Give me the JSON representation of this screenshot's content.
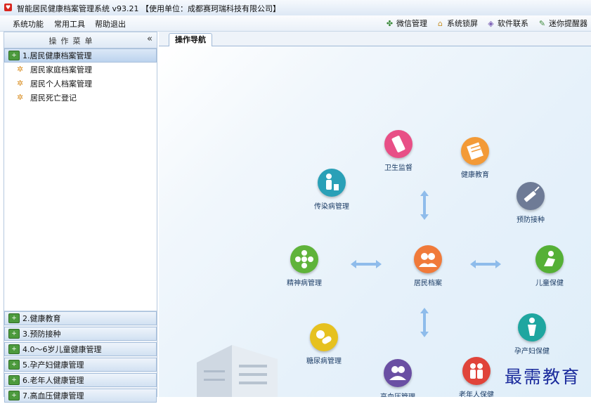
{
  "window": {
    "title": "智能居民健康档案管理系统 v93.21   【使用单位：成都赛珂瑞科技有限公司】"
  },
  "menubar": {
    "menus": [
      "系统功能",
      "常用工具",
      "帮助退出"
    ],
    "tools": [
      {
        "icon": "wechat-icon",
        "label": "微信管理"
      },
      {
        "icon": "lock-home-icon",
        "label": "系统锁屏"
      },
      {
        "icon": "diamond-contact-icon",
        "label": "软件联系"
      },
      {
        "icon": "reminder-icon",
        "label": "迷你提醒器"
      }
    ]
  },
  "sidebar": {
    "header": "操作菜单",
    "collapse_symbol": "«",
    "active_section": "1.居民健康档案管理",
    "items": [
      "居民家庭档案管理",
      "居民个人档案管理",
      "居民死亡登记"
    ],
    "sections": [
      "2.健康教育",
      "3.预防接种",
      "4.0～6岁儿童健康管理",
      "5.孕产妇健康管理",
      "6.老年人健康管理",
      "7.高血压健康管理"
    ]
  },
  "tabs": {
    "active": "操作导航"
  },
  "nav": {
    "center": {
      "label": "居民档案",
      "color": "#f07a3a",
      "icon": "people-icon"
    },
    "nodes": [
      {
        "key": "health-supervision",
        "label": "卫生监督",
        "color": "#e84f86",
        "icon": "phone-icon"
      },
      {
        "key": "health-education",
        "label": "健康教育",
        "color": "#f39a37",
        "icon": "notebook-icon"
      },
      {
        "key": "infectious-disease",
        "label": "传染病管理",
        "color": "#2aa0b7",
        "icon": "person-bin-icon"
      },
      {
        "key": "vaccination",
        "label": "预防接种",
        "color": "#6e7b96",
        "icon": "syringe-icon"
      },
      {
        "key": "mental-illness",
        "label": "精神病管理",
        "color": "#5fb33a",
        "icon": "flower-icon"
      },
      {
        "key": "child-care",
        "label": "儿童保健",
        "color": "#55b036",
        "icon": "child-icon"
      },
      {
        "key": "diabetes",
        "label": "糖尿病管理",
        "color": "#e6c11f",
        "icon": "pill-icon"
      },
      {
        "key": "maternal-care",
        "label": "孕产妇保健",
        "color": "#1fa6a0",
        "icon": "mother-icon"
      },
      {
        "key": "hypertension",
        "label": "高血压管理",
        "color": "#6a4fa3",
        "icon": "group-icon"
      },
      {
        "key": "elderly-care",
        "label": "老年人保健",
        "color": "#e0443a",
        "icon": "couple-icon"
      }
    ]
  },
  "watermark": "最需教育"
}
